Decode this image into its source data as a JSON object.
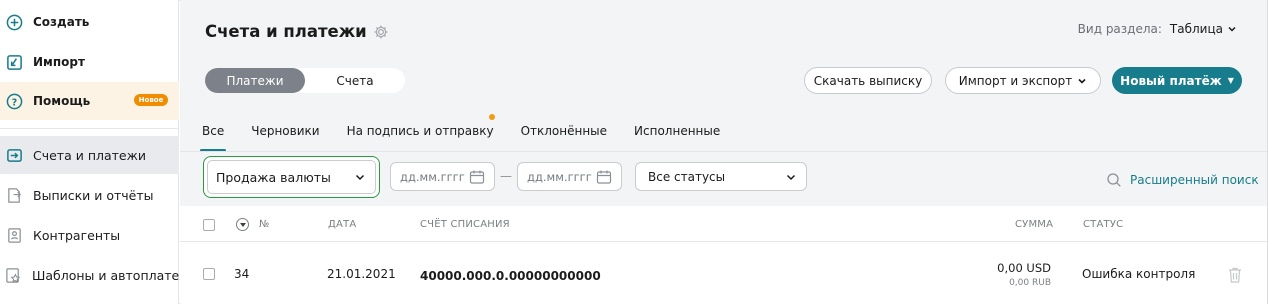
{
  "sidebar": {
    "top_items": [
      {
        "label": "Создать",
        "icon": "plus-circle-icon"
      },
      {
        "label": "Импорт",
        "icon": "import-icon"
      },
      {
        "label": "Помощь",
        "icon": "help-circle-icon",
        "badge": "Новое"
      }
    ],
    "nav_items": [
      {
        "label": "Счета и платежи",
        "icon": "arrow-in-box-icon",
        "active": true
      },
      {
        "label": "Выписки и отчёты",
        "icon": "document-out-icon"
      },
      {
        "label": "Контрагенты",
        "icon": "contact-card-icon"
      },
      {
        "label": "Шаблоны и автоплатежи",
        "icon": "template-star-icon"
      }
    ]
  },
  "header": {
    "title": "Счета и платежи",
    "view_label": "Вид раздела:",
    "view_value": "Таблица"
  },
  "segment": {
    "options": [
      "Платежи",
      "Счета"
    ],
    "selected": "Платежи"
  },
  "actions": {
    "download": "Скачать выписку",
    "import_export": "Импорт и экспорт",
    "new_payment": "Новый платёж"
  },
  "tabs": [
    {
      "label": "Все",
      "active": true
    },
    {
      "label": "Черновики"
    },
    {
      "label": "На подпись и отправку",
      "has_dot": true
    },
    {
      "label": "Отклонённые"
    },
    {
      "label": "Исполненные"
    }
  ],
  "filters": {
    "type_value": "Продажа валюты",
    "date_from_placeholder": "дд.мм.гггг",
    "date_separator": "—",
    "date_to_placeholder": "дд.мм.гггг",
    "status_value": "Все статусы",
    "advanced_search": "Расширенный поиск"
  },
  "table": {
    "columns": [
      "№",
      "ДАТА",
      "СЧЁТ СПИСАНИЯ",
      "СУММА",
      "СТАТУС"
    ],
    "rows": [
      {
        "number": "34",
        "date": "21.01.2021",
        "account": "40000.000.0.00000000000",
        "amount": "0,00 USD",
        "amount_rub": "0,00 RUB",
        "status": "Ошибка контроля"
      }
    ]
  },
  "colors": {
    "accent": "#177c8b",
    "highlight_border": "#2a9a3f",
    "badge": "#f08c00",
    "active_nav_bg": "#e8eaed"
  }
}
